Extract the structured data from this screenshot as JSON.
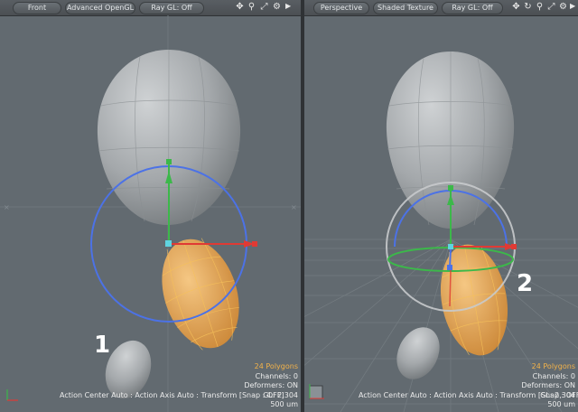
{
  "left_viewport": {
    "view_label": "Front",
    "shading_label": "Advanced OpenGL",
    "raygl_label": "Ray GL: Off",
    "icons": [
      "move-view-icon",
      "zoom-icon",
      "fit-view-icon",
      "settings-gear-icon",
      "menu-arrow-icon"
    ],
    "info": {
      "polygons": "24 Polygons",
      "channels": "Channels: 0",
      "deformers": "Deformers: ON",
      "gl": "GL: 2,304",
      "unit": "500 um"
    },
    "status_line": "Action Center Auto : Action Axis Auto : Transform  [Snap : OFF]",
    "callout": "1"
  },
  "right_viewport": {
    "view_label": "Perspective",
    "shading_label": "Shaded Texture",
    "raygl_label": "Ray GL: Off",
    "icons": [
      "move-view-icon",
      "rotate-view-icon",
      "zoom-icon",
      "fit-view-icon",
      "settings-gear-icon",
      "menu-arrow-icon"
    ],
    "info": {
      "polygons": "24 Polygons",
      "channels": "Channels: 0",
      "deformers": "Deformers: ON",
      "gl": "GL: 2,304",
      "unit": "500 um"
    },
    "status_line": "Action Center Auto : Action Axis Auto : Transform  [Snap : OFF]",
    "callout": "2"
  },
  "colors": {
    "viewport_bg": "#626a70",
    "gray_mesh": "#a9adb0",
    "selected_mesh": "#e8a453",
    "wire_selected": "#f6c15a",
    "axis_x": "#e03a34",
    "axis_y": "#3cb84a",
    "axis_z": "#3d62d6",
    "rotate_ring": "#4c72e6",
    "handle_center": "#5fd3e0",
    "poly_count": "#f2b24a"
  }
}
